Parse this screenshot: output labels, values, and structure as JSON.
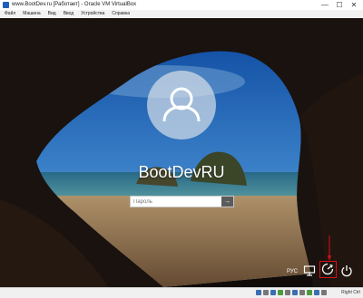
{
  "window": {
    "title": "www.BootDev.ru [Работает] - Oracle VM VirtualBox",
    "minimize_glyph": "—",
    "maximize_glyph": "☐",
    "close_glyph": "✕"
  },
  "menu": [
    "Файл",
    "Машина",
    "Вид",
    "Ввод",
    "Устройства",
    "Справка"
  ],
  "lock_screen": {
    "username": "BootDevRU",
    "password_placeholder": "Пароль",
    "submit_glyph": "→",
    "language": "РУС"
  },
  "statusbar": {
    "host_key": "Right Ctrl"
  },
  "colors": {
    "highlight": "#d8101a",
    "accent": "#1f5fbf"
  }
}
